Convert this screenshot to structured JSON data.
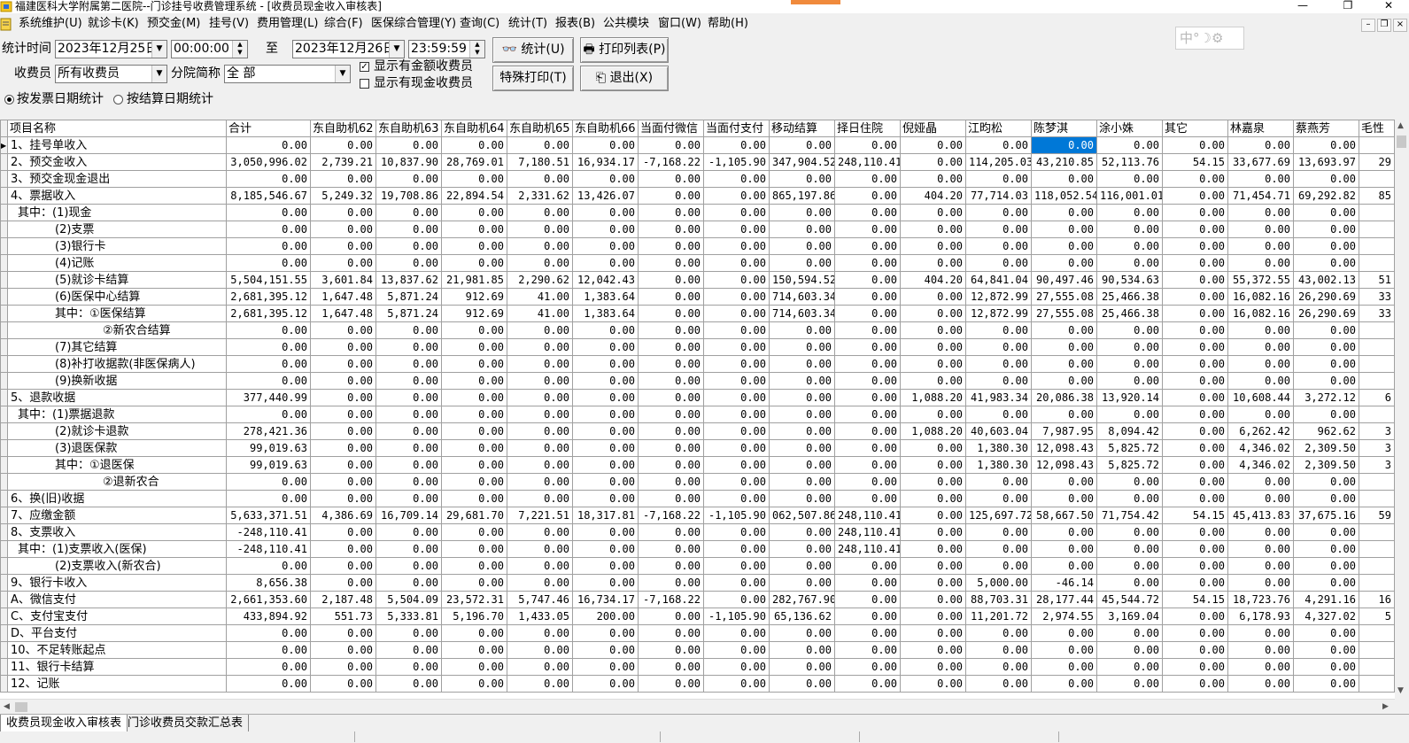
{
  "window": {
    "title": "福建医科大学附属第二医院--门诊挂号收费管理系统 - [收费员现金收入审核表]",
    "controls": [
      "—",
      "❐",
      "✕"
    ]
  },
  "menu": [
    "系统维护(U)",
    "就诊卡(K)",
    "预交金(M)",
    "挂号(V)",
    "费用管理(L)",
    "综合(F)",
    "医保综合管理(Y)",
    "查询(C)",
    "统计(T)",
    "报表(B)",
    "公共模块",
    "窗口(W)",
    "帮助(H)"
  ],
  "mdi_controls": [
    "–",
    "❐",
    "×"
  ],
  "filters": {
    "stat_time_label": "统计时间",
    "start_date": "2023年12月25日",
    "start_time": "00:00:00",
    "to_label": "至",
    "end_date": "2023年12月26日",
    "end_time": "23:59:59",
    "cashier_label": "收费员",
    "cashier_value": "所有收费员",
    "branch_label": "分院简称",
    "branch_value": "全 部",
    "show_amount_label": "显示有金额收费员",
    "show_amount_checked": true,
    "show_cash_label": "显示有现金收费员",
    "show_cash_checked": false,
    "radio_invoice_label": "按发票日期统计",
    "radio_invoice_selected": true,
    "radio_settle_label": "按结算日期统计",
    "radio_settle_selected": false
  },
  "buttons": {
    "stat": "统计(U)",
    "print_list": "打印列表(P)",
    "special_print": "特殊打印(T)",
    "exit": "退出(X)"
  },
  "ime": {
    "text": "中°☽⚙"
  },
  "table": {
    "columns": [
      "项目名称",
      "合计",
      "东自助机62",
      "东自助机63",
      "东自助机64",
      "东自助机65",
      "东自助机66",
      "当面付微信",
      "当面付支付",
      "移动结算",
      "择日住院",
      "倪娅晶",
      "江昀松",
      "陈梦淇",
      "涂小姝",
      "其它",
      "林嘉泉",
      "蔡燕芳",
      "毛性"
    ],
    "selected_row": 0,
    "selected_col": 13,
    "rows": [
      [
        "1、挂号单收入",
        "0.00",
        "0.00",
        "0.00",
        "0.00",
        "0.00",
        "0.00",
        "0.00",
        "0.00",
        "0.00",
        "0.00",
        "0.00",
        "0.00",
        "0.00",
        "0.00",
        "0.00",
        "0.00",
        "0.00",
        ""
      ],
      [
        "2、预交金收入",
        "3,050,996.02",
        "2,739.21",
        "10,837.90",
        "28,769.01",
        "7,180.51",
        "16,934.17",
        "-7,168.22",
        "-1,105.90",
        "347,904.52",
        "248,110.41",
        "0.00",
        "114,205.03",
        "43,210.85",
        "52,113.76",
        "54.15",
        "33,677.69",
        "13,693.97",
        "29"
      ],
      [
        "3、预交金现金退出",
        "0.00",
        "0.00",
        "0.00",
        "0.00",
        "0.00",
        "0.00",
        "0.00",
        "0.00",
        "0.00",
        "0.00",
        "0.00",
        "0.00",
        "0.00",
        "0.00",
        "0.00",
        "0.00",
        "0.00",
        ""
      ],
      [
        "4、票据收入",
        "8,185,546.67",
        "5,249.32",
        "19,708.86",
        "22,894.54",
        "2,331.62",
        "13,426.07",
        "0.00",
        "0.00",
        "865,197.86",
        "0.00",
        "404.20",
        "77,714.03",
        "118,052.54",
        "116,001.01",
        "0.00",
        "71,454.71",
        "69,292.82",
        "85"
      ],
      [
        "其中：(1)现金",
        "0.00",
        "0.00",
        "0.00",
        "0.00",
        "0.00",
        "0.00",
        "0.00",
        "0.00",
        "0.00",
        "0.00",
        "0.00",
        "0.00",
        "0.00",
        "0.00",
        "0.00",
        "0.00",
        "0.00",
        ""
      ],
      [
        "(2)支票",
        "0.00",
        "0.00",
        "0.00",
        "0.00",
        "0.00",
        "0.00",
        "0.00",
        "0.00",
        "0.00",
        "0.00",
        "0.00",
        "0.00",
        "0.00",
        "0.00",
        "0.00",
        "0.00",
        "0.00",
        ""
      ],
      [
        "(3)银行卡",
        "0.00",
        "0.00",
        "0.00",
        "0.00",
        "0.00",
        "0.00",
        "0.00",
        "0.00",
        "0.00",
        "0.00",
        "0.00",
        "0.00",
        "0.00",
        "0.00",
        "0.00",
        "0.00",
        "0.00",
        ""
      ],
      [
        "(4)记账",
        "0.00",
        "0.00",
        "0.00",
        "0.00",
        "0.00",
        "0.00",
        "0.00",
        "0.00",
        "0.00",
        "0.00",
        "0.00",
        "0.00",
        "0.00",
        "0.00",
        "0.00",
        "0.00",
        "0.00",
        ""
      ],
      [
        "(5)就诊卡结算",
        "5,504,151.55",
        "3,601.84",
        "13,837.62",
        "21,981.85",
        "2,290.62",
        "12,042.43",
        "0.00",
        "0.00",
        "150,594.52",
        "0.00",
        "404.20",
        "64,841.04",
        "90,497.46",
        "90,534.63",
        "0.00",
        "55,372.55",
        "43,002.13",
        "51"
      ],
      [
        "(6)医保中心结算",
        "2,681,395.12",
        "1,647.48",
        "5,871.24",
        "912.69",
        "41.00",
        "1,383.64",
        "0.00",
        "0.00",
        "714,603.34",
        "0.00",
        "0.00",
        "12,872.99",
        "27,555.08",
        "25,466.38",
        "0.00",
        "16,082.16",
        "26,290.69",
        "33"
      ],
      [
        "其中：①医保结算",
        "2,681,395.12",
        "1,647.48",
        "5,871.24",
        "912.69",
        "41.00",
        "1,383.64",
        "0.00",
        "0.00",
        "714,603.34",
        "0.00",
        "0.00",
        "12,872.99",
        "27,555.08",
        "25,466.38",
        "0.00",
        "16,082.16",
        "26,290.69",
        "33"
      ],
      [
        "②新农合结算",
        "0.00",
        "0.00",
        "0.00",
        "0.00",
        "0.00",
        "0.00",
        "0.00",
        "0.00",
        "0.00",
        "0.00",
        "0.00",
        "0.00",
        "0.00",
        "0.00",
        "0.00",
        "0.00",
        "0.00",
        ""
      ],
      [
        "(7)其它结算",
        "0.00",
        "0.00",
        "0.00",
        "0.00",
        "0.00",
        "0.00",
        "0.00",
        "0.00",
        "0.00",
        "0.00",
        "0.00",
        "0.00",
        "0.00",
        "0.00",
        "0.00",
        "0.00",
        "0.00",
        ""
      ],
      [
        "(8)补打收据款(非医保病人)",
        "0.00",
        "0.00",
        "0.00",
        "0.00",
        "0.00",
        "0.00",
        "0.00",
        "0.00",
        "0.00",
        "0.00",
        "0.00",
        "0.00",
        "0.00",
        "0.00",
        "0.00",
        "0.00",
        "0.00",
        ""
      ],
      [
        "(9)换新收据",
        "0.00",
        "0.00",
        "0.00",
        "0.00",
        "0.00",
        "0.00",
        "0.00",
        "0.00",
        "0.00",
        "0.00",
        "0.00",
        "0.00",
        "0.00",
        "0.00",
        "0.00",
        "0.00",
        "0.00",
        ""
      ],
      [
        "5、退款收据",
        "377,440.99",
        "0.00",
        "0.00",
        "0.00",
        "0.00",
        "0.00",
        "0.00",
        "0.00",
        "0.00",
        "0.00",
        "1,088.20",
        "41,983.34",
        "20,086.38",
        "13,920.14",
        "0.00",
        "10,608.44",
        "3,272.12",
        "6"
      ],
      [
        "其中：(1)票据退款",
        "0.00",
        "0.00",
        "0.00",
        "0.00",
        "0.00",
        "0.00",
        "0.00",
        "0.00",
        "0.00",
        "0.00",
        "0.00",
        "0.00",
        "0.00",
        "0.00",
        "0.00",
        "0.00",
        "0.00",
        ""
      ],
      [
        "(2)就诊卡退款",
        "278,421.36",
        "0.00",
        "0.00",
        "0.00",
        "0.00",
        "0.00",
        "0.00",
        "0.00",
        "0.00",
        "0.00",
        "1,088.20",
        "40,603.04",
        "7,987.95",
        "8,094.42",
        "0.00",
        "6,262.42",
        "962.62",
        "3"
      ],
      [
        "(3)退医保款",
        "99,019.63",
        "0.00",
        "0.00",
        "0.00",
        "0.00",
        "0.00",
        "0.00",
        "0.00",
        "0.00",
        "0.00",
        "0.00",
        "1,380.30",
        "12,098.43",
        "5,825.72",
        "0.00",
        "4,346.02",
        "2,309.50",
        "3"
      ],
      [
        "其中：①退医保",
        "99,019.63",
        "0.00",
        "0.00",
        "0.00",
        "0.00",
        "0.00",
        "0.00",
        "0.00",
        "0.00",
        "0.00",
        "0.00",
        "1,380.30",
        "12,098.43",
        "5,825.72",
        "0.00",
        "4,346.02",
        "2,309.50",
        "3"
      ],
      [
        "②退新农合",
        "0.00",
        "0.00",
        "0.00",
        "0.00",
        "0.00",
        "0.00",
        "0.00",
        "0.00",
        "0.00",
        "0.00",
        "0.00",
        "0.00",
        "0.00",
        "0.00",
        "0.00",
        "0.00",
        "0.00",
        ""
      ],
      [
        "6、换(旧)收据",
        "0.00",
        "0.00",
        "0.00",
        "0.00",
        "0.00",
        "0.00",
        "0.00",
        "0.00",
        "0.00",
        "0.00",
        "0.00",
        "0.00",
        "0.00",
        "0.00",
        "0.00",
        "0.00",
        "0.00",
        ""
      ],
      [
        "7、应缴金额",
        "5,633,371.51",
        "4,386.69",
        "16,709.14",
        "29,681.70",
        "7,221.51",
        "18,317.81",
        "-7,168.22",
        "-1,105.90",
        "062,507.86",
        "248,110.41",
        "0.00",
        "125,697.72",
        "58,667.50",
        "71,754.42",
        "54.15",
        "45,413.83",
        "37,675.16",
        "59"
      ],
      [
        "8、支票收入",
        "-248,110.41",
        "0.00",
        "0.00",
        "0.00",
        "0.00",
        "0.00",
        "0.00",
        "0.00",
        "0.00",
        "248,110.41",
        "0.00",
        "0.00",
        "0.00",
        "0.00",
        "0.00",
        "0.00",
        "0.00",
        ""
      ],
      [
        "其中：(1)支票收入(医保)",
        "-248,110.41",
        "0.00",
        "0.00",
        "0.00",
        "0.00",
        "0.00",
        "0.00",
        "0.00",
        "0.00",
        "248,110.41",
        "0.00",
        "0.00",
        "0.00",
        "0.00",
        "0.00",
        "0.00",
        "0.00",
        ""
      ],
      [
        "(2)支票收入(新农合)",
        "0.00",
        "0.00",
        "0.00",
        "0.00",
        "0.00",
        "0.00",
        "0.00",
        "0.00",
        "0.00",
        "0.00",
        "0.00",
        "0.00",
        "0.00",
        "0.00",
        "0.00",
        "0.00",
        "0.00",
        ""
      ],
      [
        "9、银行卡收入",
        "8,656.38",
        "0.00",
        "0.00",
        "0.00",
        "0.00",
        "0.00",
        "0.00",
        "0.00",
        "0.00",
        "0.00",
        "0.00",
        "5,000.00",
        "-46.14",
        "0.00",
        "0.00",
        "0.00",
        "0.00",
        ""
      ],
      [
        "A、微信支付",
        "2,661,353.60",
        "2,187.48",
        "5,504.09",
        "23,572.31",
        "5,747.46",
        "16,734.17",
        "-7,168.22",
        "0.00",
        "282,767.90",
        "0.00",
        "0.00",
        "88,703.31",
        "28,177.44",
        "45,544.72",
        "54.15",
        "18,723.76",
        "4,291.16",
        "16"
      ],
      [
        "C、支付宝支付",
        "433,894.92",
        "551.73",
        "5,333.81",
        "5,196.70",
        "1,433.05",
        "200.00",
        "0.00",
        "-1,105.90",
        "65,136.62",
        "0.00",
        "0.00",
        "11,201.72",
        "2,974.55",
        "3,169.04",
        "0.00",
        "6,178.93",
        "4,327.02",
        "5"
      ],
      [
        "D、平台支付",
        "0.00",
        "0.00",
        "0.00",
        "0.00",
        "0.00",
        "0.00",
        "0.00",
        "0.00",
        "0.00",
        "0.00",
        "0.00",
        "0.00",
        "0.00",
        "0.00",
        "0.00",
        "0.00",
        "0.00",
        ""
      ],
      [
        "10、不足转账起点",
        "0.00",
        "0.00",
        "0.00",
        "0.00",
        "0.00",
        "0.00",
        "0.00",
        "0.00",
        "0.00",
        "0.00",
        "0.00",
        "0.00",
        "0.00",
        "0.00",
        "0.00",
        "0.00",
        "0.00",
        ""
      ],
      [
        "11、银行卡结算",
        "0.00",
        "0.00",
        "0.00",
        "0.00",
        "0.00",
        "0.00",
        "0.00",
        "0.00",
        "0.00",
        "0.00",
        "0.00",
        "0.00",
        "0.00",
        "0.00",
        "0.00",
        "0.00",
        "0.00",
        ""
      ],
      [
        "12、记账",
        "0.00",
        "0.00",
        "0.00",
        "0.00",
        "0.00",
        "0.00",
        "0.00",
        "0.00",
        "0.00",
        "0.00",
        "0.00",
        "0.00",
        "0.00",
        "0.00",
        "0.00",
        "0.00",
        "0.00",
        ""
      ]
    ]
  },
  "tabs": [
    {
      "label": "收费员现金收入审核表",
      "active": true
    },
    {
      "label": "门诊收费员交款汇总表",
      "active": false
    }
  ]
}
